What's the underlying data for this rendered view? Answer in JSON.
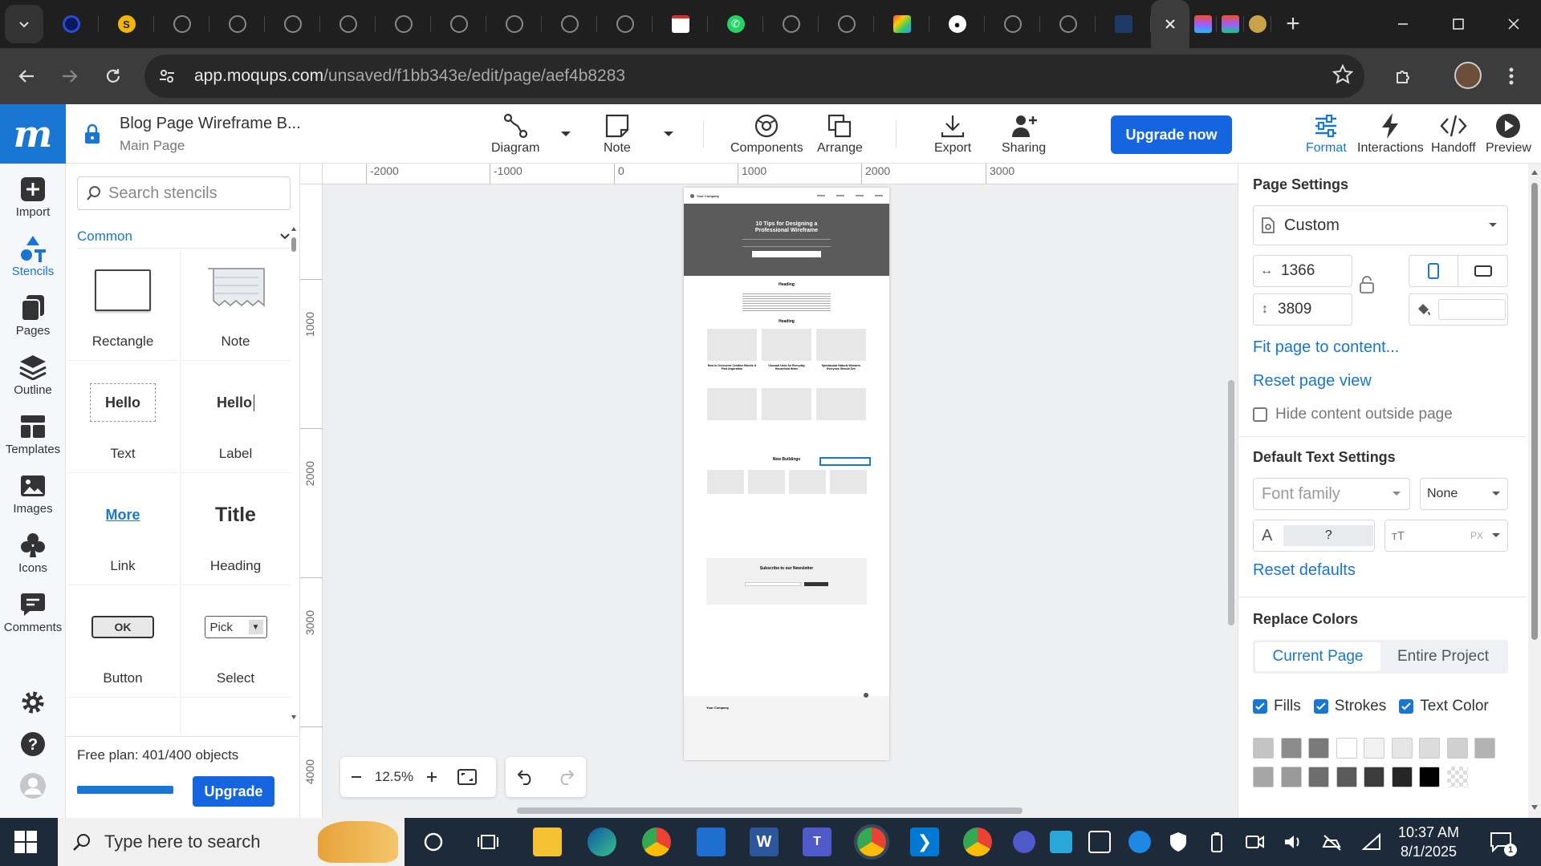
{
  "browser": {
    "tabs": [
      {
        "icon": "blue-circle-icon"
      },
      {
        "icon": "gold-swirl-icon"
      },
      {
        "icon": "globe-icon"
      },
      {
        "icon": "globe-icon"
      },
      {
        "icon": "globe-icon"
      },
      {
        "icon": "globe-icon"
      },
      {
        "icon": "globe-icon"
      },
      {
        "icon": "globe-icon"
      },
      {
        "icon": "globe-icon"
      },
      {
        "icon": "globe-icon"
      },
      {
        "icon": "globe-icon"
      },
      {
        "icon": "gmail-icon"
      },
      {
        "icon": "whatsapp-icon"
      },
      {
        "icon": "globe-icon"
      },
      {
        "icon": "globe-icon"
      },
      {
        "icon": "colorful-x-icon"
      },
      {
        "icon": "github-icon"
      },
      {
        "icon": "globe-icon"
      },
      {
        "icon": "globe-icon"
      },
      {
        "icon": "moqups-man-icon"
      }
    ],
    "url_host": "app.moqups.com",
    "url_path": "/unsaved/f1bb343e/edit/page/aef4b8283"
  },
  "app": {
    "logo": "m",
    "doc_title": "Blog Page Wireframe B...",
    "doc_subtitle": "Main Page",
    "toolbar": {
      "diagram": "Diagram",
      "note": "Note",
      "components": "Components",
      "arrange": "Arrange",
      "export": "Export",
      "sharing": "Sharing",
      "upgrade_now": "Upgrade now",
      "format": "Format",
      "interactions": "Interactions",
      "handoff": "Handoff",
      "preview": "Preview"
    },
    "accent": "#1976d2"
  },
  "rail": {
    "import": "Import",
    "stencils": "Stencils",
    "pages": "Pages",
    "outline": "Outline",
    "templates": "Templates",
    "images": "Images",
    "icons": "Icons",
    "comments": "Comments"
  },
  "stencils": {
    "search_placeholder": "Search stencils",
    "group": "Common",
    "items": {
      "rectangle": "Rectangle",
      "note": "Note",
      "text": "Text",
      "text_preview": "Hello",
      "label": "Label",
      "label_preview": "Hello",
      "link": "Link",
      "link_preview": "More",
      "heading": "Heading",
      "heading_preview": "Title",
      "button": "Button",
      "button_preview": "OK",
      "select": "Select",
      "select_preview": "Pick"
    },
    "plan_text": "Free plan: 401/400 objects",
    "plan_fill": 1.0,
    "upgrade": "Upgrade"
  },
  "canvas": {
    "ruler_h": [
      "-2000",
      "-1000",
      "0",
      "1000",
      "2000",
      "3000"
    ],
    "ruler_v": [
      "1000",
      "2000",
      "3000",
      "4000"
    ],
    "zoom": "12.5%",
    "page": {
      "company": "Your Company",
      "hero_title_1": "10 Tips for Designing a",
      "hero_title_2": "Professional Wireframe",
      "heading1": "Heading",
      "heading2": "Heading",
      "section_new": "New Buildings",
      "newsletter": "Subscribe to our Newsletter",
      "card_titles": [
        "How to Overcome Creative Blocks & Find Inspiration",
        "Unusual Uses for Everyday Household Items",
        "Spectacular Natural Wonders Everyone Should See"
      ],
      "footer_company": "Your Company"
    }
  },
  "format_panel": {
    "page_settings": "Page Settings",
    "preset": "Custom",
    "width": "1366",
    "height": "3809",
    "fit_page": "Fit page to content...",
    "reset_view": "Reset page view",
    "hide_outside": "Hide content outside page",
    "default_text": "Default Text Settings",
    "font_family_placeholder": "Font family",
    "font_weight": "None",
    "font_size_value": "?",
    "font_size_unit": "PX",
    "reset_defaults": "Reset defaults",
    "replace_colors": "Replace Colors",
    "tab_current": "Current Page",
    "tab_entire": "Entire Project",
    "fills": "Fills",
    "strokes": "Strokes",
    "text_color": "Text Color",
    "swatches_row1": [
      "#c4c4c4",
      "#8c8c8c",
      "#7a7a7a",
      "#ffffff",
      "#f2f2f2",
      "#e6e6e6",
      "#dcdcdc",
      "#d0d0d0",
      "#b3b3b3"
    ],
    "swatches_row2": [
      "#a6a6a6",
      "#9a9a9a",
      "#6e6e6e",
      "#5a5a5a",
      "#3c3c3c",
      "#262626",
      "#000000",
      "transparent"
    ]
  },
  "taskbar": {
    "search_placeholder": "Type here to search",
    "time": "10:37 AM",
    "date": "8/1/2025",
    "notifications": "1"
  }
}
